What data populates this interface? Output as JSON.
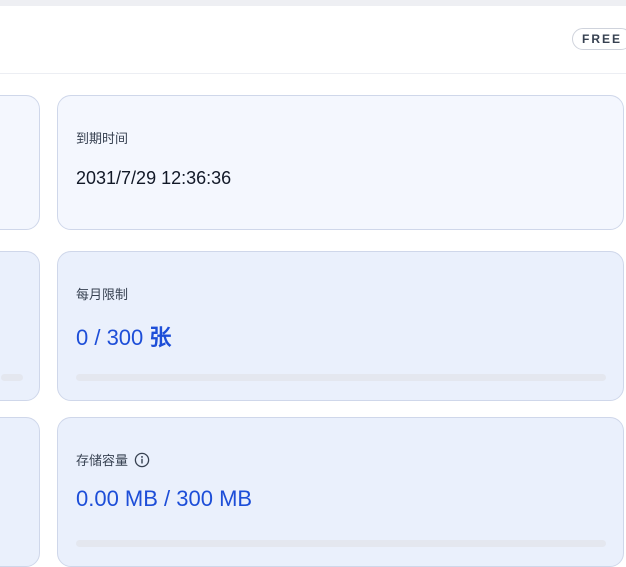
{
  "header": {
    "plan_badge": "FREE"
  },
  "cards": {
    "expiry": {
      "label": "到期时间",
      "value": "2031/7/29 12:36:36"
    },
    "monthly_limit": {
      "label": "每月限制",
      "value": "0 / 300",
      "unit": "张",
      "progress": 0
    },
    "storage": {
      "label": "存储容量",
      "value": "0.00 MB / 300 MB",
      "info_icon": "info-circle-icon",
      "progress": 0
    }
  },
  "colors": {
    "accent": "#1d4ed8",
    "card_border": "#cfd7ea",
    "card_bg": "#eaf0fc"
  }
}
